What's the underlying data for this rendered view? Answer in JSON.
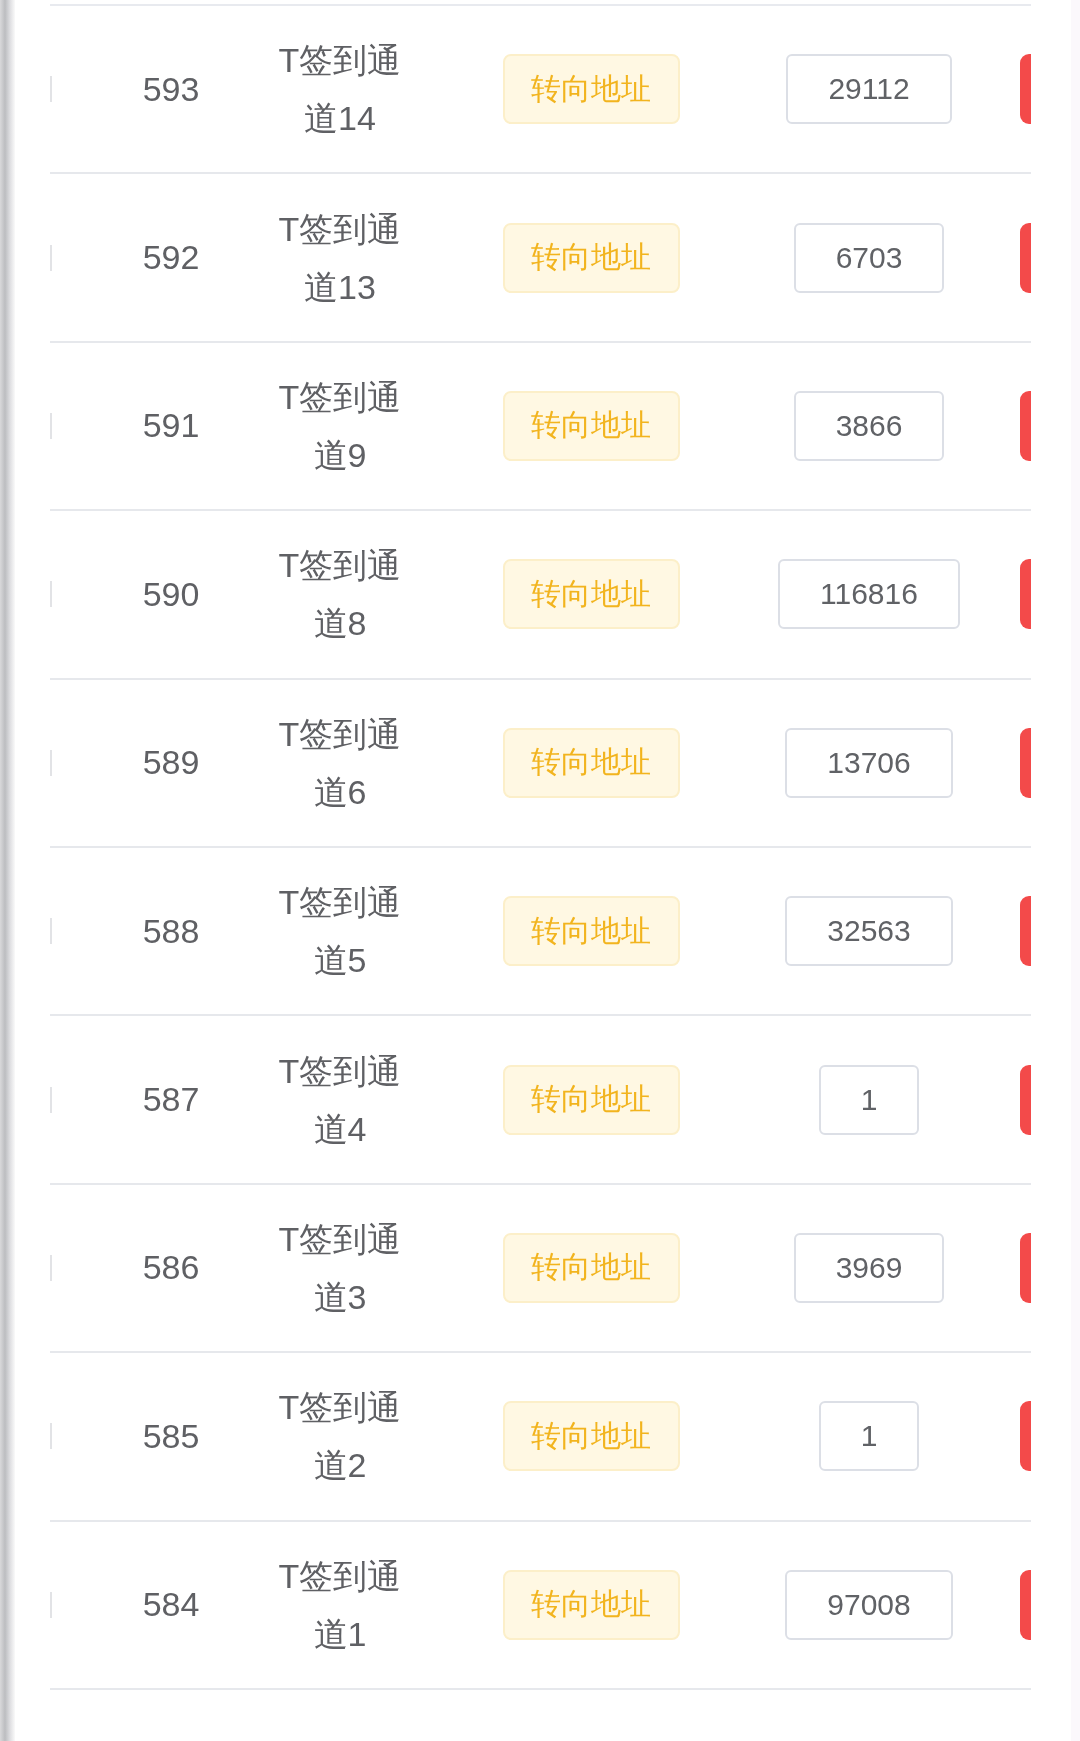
{
  "rows": [
    {
      "id": "593",
      "name": "T签到通道14",
      "action": "转向地址",
      "value": "29112"
    },
    {
      "id": "592",
      "name": "T签到通道13",
      "action": "转向地址",
      "value": "6703"
    },
    {
      "id": "591",
      "name": "T签到通道9",
      "action": "转向地址",
      "value": "3866"
    },
    {
      "id": "590",
      "name": "T签到通道8",
      "action": "转向地址",
      "value": "116816"
    },
    {
      "id": "589",
      "name": "T签到通道6",
      "action": "转向地址",
      "value": "13706"
    },
    {
      "id": "588",
      "name": "T签到通道5",
      "action": "转向地址",
      "value": "32563"
    },
    {
      "id": "587",
      "name": "T签到通道4",
      "action": "转向地址",
      "value": "1"
    },
    {
      "id": "586",
      "name": "T签到通道3",
      "action": "转向地址",
      "value": "3969"
    },
    {
      "id": "585",
      "name": "T签到通道2",
      "action": "转向地址",
      "value": "1"
    },
    {
      "id": "584",
      "name": "T签到通道1",
      "action": "转向地址",
      "value": "97008"
    }
  ]
}
